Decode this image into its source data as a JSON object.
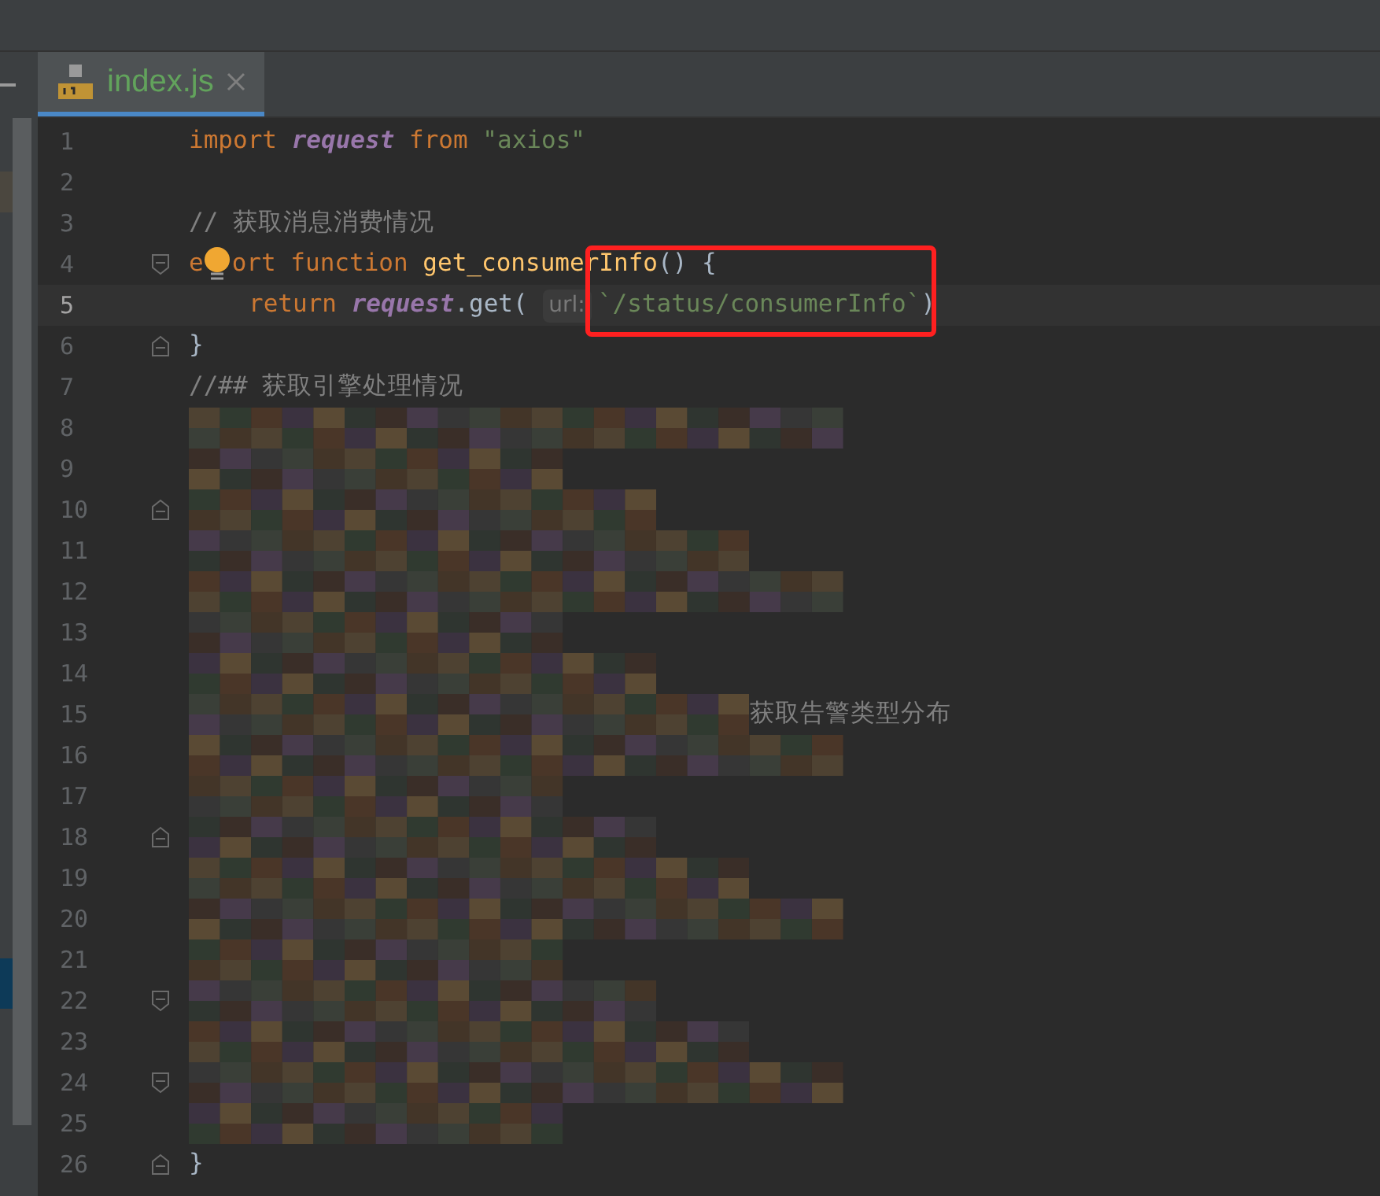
{
  "tab": {
    "label": "index.js",
    "selected": true
  },
  "lines": [
    {
      "number": "1",
      "tokens": [
        {
          "kind": "keyword",
          "text": "import "
        },
        {
          "kind": "ref",
          "text": "request"
        },
        {
          "kind": "keyword",
          "text": " from "
        },
        {
          "kind": "string",
          "text": "\"axios\""
        }
      ]
    },
    {
      "number": "2"
    },
    {
      "number": "3",
      "tokens": [
        {
          "kind": "comment",
          "text": "// 获取消息消费情况"
        }
      ]
    },
    {
      "number": "4",
      "fold_open": true,
      "tokens": [
        {
          "kind": "keyword",
          "text": "e"
        },
        {
          "kind": "bulb"
        },
        {
          "kind": "keyword",
          "text": "ort function "
        },
        {
          "kind": "function",
          "text": "get_consumerInfo"
        },
        {
          "kind": "plain",
          "text": "() {"
        }
      ]
    },
    {
      "number": "5",
      "current": true,
      "indented": true,
      "tokens": [
        {
          "kind": "keyword",
          "text": "return "
        },
        {
          "kind": "ref",
          "text": "request"
        },
        {
          "kind": "plain",
          "text": ".get( "
        },
        {
          "kind": "hint",
          "text": "url:"
        },
        {
          "kind": "string",
          "text": "`/status/consumerInfo`",
          "boxed": true
        },
        {
          "kind": "plain",
          "text": ")"
        }
      ]
    },
    {
      "number": "6",
      "fold_close": true,
      "tokens": [
        {
          "kind": "plain",
          "text": "}"
        }
      ]
    },
    {
      "number": "7",
      "tokens": [
        {
          "kind": "comment",
          "text": "//## 获取引擎处理情况"
        }
      ]
    },
    {
      "number": "8",
      "tokens": [
        {
          "kind": "mosaic"
        }
      ]
    },
    {
      "number": "9",
      "tokens": [
        {
          "kind": "mosaic"
        }
      ]
    },
    {
      "number": "10",
      "fold_close": true,
      "tokens": [
        {
          "kind": "mosaic"
        }
      ]
    },
    {
      "number": "11",
      "tokens": [
        {
          "kind": "mosaic"
        }
      ]
    },
    {
      "number": "12",
      "tokens": [
        {
          "kind": "mosaic"
        }
      ]
    },
    {
      "number": "13",
      "tokens": [
        {
          "kind": "mosaic"
        }
      ]
    },
    {
      "number": "14",
      "tokens": [
        {
          "kind": "mosaic"
        }
      ]
    },
    {
      "number": "15",
      "tokens": [
        {
          "kind": "mosaic"
        },
        {
          "kind": "comment",
          "text": "获取告警类型分布"
        }
      ]
    },
    {
      "number": "16",
      "tokens": [
        {
          "kind": "mosaic"
        }
      ]
    },
    {
      "number": "17",
      "tokens": [
        {
          "kind": "mosaic"
        }
      ]
    },
    {
      "number": "18",
      "fold_close": true,
      "tokens": [
        {
          "kind": "mosaic"
        }
      ]
    },
    {
      "number": "19",
      "tokens": [
        {
          "kind": "mosaic"
        }
      ]
    },
    {
      "number": "20",
      "tokens": [
        {
          "kind": "mosaic"
        }
      ]
    },
    {
      "number": "21",
      "tokens": [
        {
          "kind": "mosaic"
        }
      ]
    },
    {
      "number": "22",
      "fold_open": true,
      "tokens": [
        {
          "kind": "mosaic"
        }
      ]
    },
    {
      "number": "23",
      "tokens": [
        {
          "kind": "mosaic"
        }
      ]
    },
    {
      "number": "24",
      "fold_open": true,
      "tokens": [
        {
          "kind": "mosaic"
        }
      ]
    },
    {
      "number": "25",
      "tokens": [
        {
          "kind": "mosaic"
        }
      ]
    },
    {
      "number": "26",
      "fold_close": true,
      "tokens": [
        {
          "kind": "plain",
          "text": "}"
        }
      ]
    }
  ]
}
